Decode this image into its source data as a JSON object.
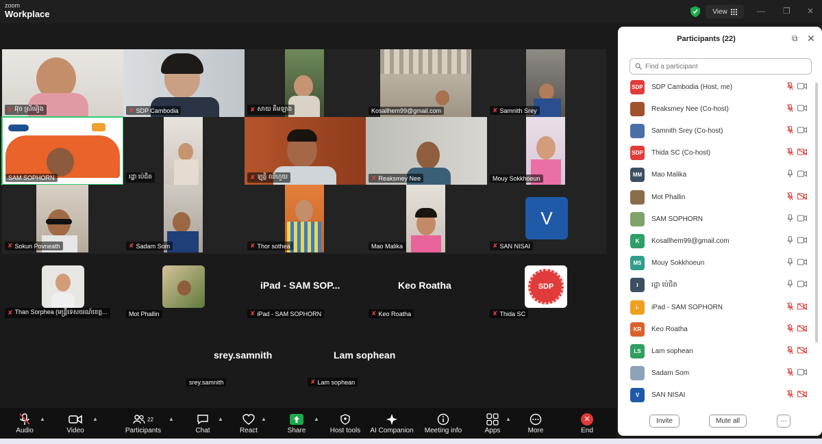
{
  "app": {
    "brand_top": "zoom",
    "brand_bottom": "Workplace",
    "view_label": "View"
  },
  "tiles": [
    {
      "name": "អ៊ុច ស្រីម៉ៀង",
      "muted": true
    },
    {
      "name": "SDP Cambodia",
      "muted": true
    },
    {
      "name": "សាយ គីមឡាង",
      "muted": true
    },
    {
      "name": "Kosallhem99@gmail.com",
      "muted": false
    },
    {
      "name": "Samnith Srey",
      "muted": true
    },
    {
      "name": "SAM SOPHORN",
      "muted": false
    },
    {
      "name": "រដ្ឋា ប៉េជិត",
      "muted": false
    },
    {
      "name": "ឡុត្តិ ឈីហួយ",
      "muted": true
    },
    {
      "name": "Reaksmey Nee",
      "muted": true
    },
    {
      "name": "Mouy Sokkhoeun",
      "muted": false
    },
    {
      "name": "Sokun Povneath",
      "muted": true
    },
    {
      "name": "Sadam Som",
      "muted": true
    },
    {
      "name": "Thor sothea",
      "muted": true
    },
    {
      "name": "Mao Malika",
      "muted": false
    },
    {
      "name": "SAN NISAI",
      "muted": true
    },
    {
      "name": "Than Sorphea (មន្ត្រីទេសចរណ៍ខេត្ត...",
      "muted": true
    },
    {
      "name": "Mot Phallin",
      "muted": false
    },
    {
      "name": "iPad - SAM SOPHORN",
      "muted": true
    },
    {
      "name": "Keo Roatha",
      "muted": true
    },
    {
      "name": "Thida SC",
      "muted": true
    },
    {
      "name": "srey.samnith",
      "muted": false
    },
    {
      "name": "Lam sophean",
      "muted": true
    }
  ],
  "big_names": {
    "ipad": "iPad - SAM SOP...",
    "keo": "Keo Roatha",
    "srey": "srey.samnith",
    "lam": "Lam sophean"
  },
  "avatar_letters": {
    "san_nisai": "V",
    "thida": "SDP"
  },
  "toolbar": [
    {
      "label": "Audio",
      "icon": "microphone-muted-icon"
    },
    {
      "label": "Video",
      "icon": "camera-icon"
    },
    {
      "label": "Participants",
      "icon": "participants-icon",
      "count": "22"
    },
    {
      "label": "Chat",
      "icon": "chat-icon"
    },
    {
      "label": "React",
      "icon": "heart-icon"
    },
    {
      "label": "Share",
      "icon": "share-icon"
    },
    {
      "label": "Host tools",
      "icon": "shield-icon"
    },
    {
      "label": "AI Companion",
      "icon": "sparkle-icon"
    },
    {
      "label": "Meeting info",
      "icon": "info-icon"
    },
    {
      "label": "Apps",
      "icon": "apps-icon"
    },
    {
      "label": "More",
      "icon": "more-icon"
    },
    {
      "label": "End",
      "icon": "end-icon"
    }
  ],
  "panel": {
    "title": "Participants (22)",
    "search_placeholder": "Find a participant",
    "invite": "Invite",
    "mute_all": "Mute all",
    "more": "···",
    "participants": [
      {
        "name": "SDP Cambodia (Host, me)",
        "avatar": "SDP",
        "color": "#e23b3b",
        "mic": "muted",
        "cam": "on"
      },
      {
        "name": "Reaksmey Nee (Co-host)",
        "avatar": "",
        "color": "#a0522d",
        "mic": "muted",
        "cam": "on"
      },
      {
        "name": "Samnith Srey (Co-host)",
        "avatar": "",
        "color": "#4a6fa5",
        "mic": "muted",
        "cam": "on"
      },
      {
        "name": "Thida SC (Co-host)",
        "avatar": "SDP",
        "color": "#e23b3b",
        "mic": "muted",
        "cam": "off"
      },
      {
        "name": "Mao Malika",
        "avatar": "MM",
        "color": "#3d4f63",
        "mic": "on",
        "cam": "on"
      },
      {
        "name": "Mot Phallin",
        "avatar": "",
        "color": "#8a6d4a",
        "mic": "muted",
        "cam": "off"
      },
      {
        "name": "SAM SOPHORN",
        "avatar": "",
        "color": "#7fa36b",
        "mic": "on",
        "cam": "on"
      },
      {
        "name": "Kosallhem99@gmail.com",
        "avatar": "K",
        "color": "#2f9e6a",
        "mic": "on",
        "cam": "on"
      },
      {
        "name": "Mouy Sokkhoeun",
        "avatar": "MS",
        "color": "#2f9e8a",
        "mic": "on",
        "cam": "on"
      },
      {
        "name": "រដ្ឋា ប៉េជិត",
        "avatar": "រ",
        "color": "#3d4f63",
        "mic": "on",
        "cam": "on"
      },
      {
        "name": "iPad - SAM SOPHORN",
        "avatar": "i-",
        "color": "#f0a020",
        "mic": "muted",
        "cam": "off"
      },
      {
        "name": "Keo Roatha",
        "avatar": "KR",
        "color": "#d9622b",
        "mic": "muted",
        "cam": "off"
      },
      {
        "name": "Lam sophean",
        "avatar": "LS",
        "color": "#2fa060",
        "mic": "muted",
        "cam": "off"
      },
      {
        "name": "Sadam Som",
        "avatar": "",
        "color": "#8fa3b8",
        "mic": "muted",
        "cam": "on"
      },
      {
        "name": "SAN NISAI",
        "avatar": "V",
        "color": "#1f5aa8",
        "mic": "muted",
        "cam": "off"
      }
    ]
  }
}
